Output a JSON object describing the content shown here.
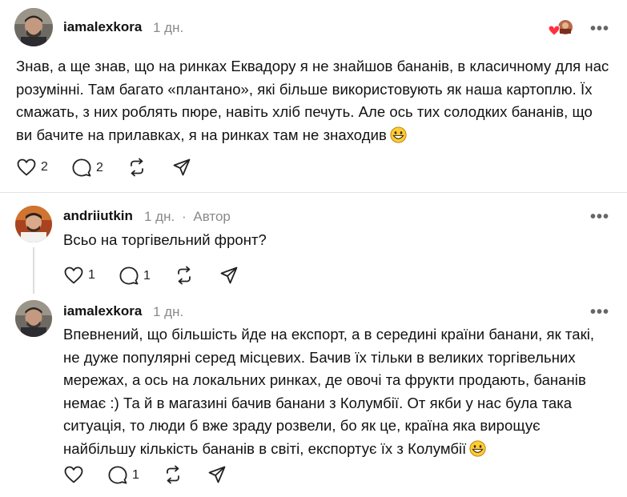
{
  "post": {
    "username": "iamalexkora",
    "time": "1 дн.",
    "lines": [
      "Знав, а ще знав, що на ринках Еквадору я не знайшов бананів, в класичному для нас",
      "розумінні. Там багато «плантано», які більше використовують як наша картоплю. Їх",
      "смажать, з них роблять пюре, навіть хліб печуть. Але ось тих солодких бананів, що",
      "ви бачите на прилавках, я на ринках там не знаходив"
    ],
    "likes": "2",
    "replies": "2",
    "more": "•••"
  },
  "reply1": {
    "username": "andriiutkin",
    "time": "1 дн.",
    "separator": "·",
    "author_badge": "Автор",
    "text": "Всьо на торгівельний фронт?",
    "likes": "1",
    "replies": "1",
    "more": "•••"
  },
  "reply2": {
    "username": "iamalexkora",
    "time": "1 дн.",
    "lines": [
      "Впевнений, що більшість йде на експорт, а в середині країни банани, як такі,",
      "не дуже популярні серед місцевих. Бачив їх тільки в великих торгівельних",
      "мережах, а ось на локальних ринках, де овочі та фрукти продають, бананів",
      "немає :) Та й в магазині бачив банани з Колумбії. От якби у нас була така",
      "ситуація, то люди б вже зраду розвели, бо як це, країна яка вирощує",
      "найбільшу кількість бананів в світі, експортує їх з Колумбії"
    ],
    "replies": "1",
    "more": "•••"
  },
  "icons": {
    "like": "heart-outline-icon",
    "reply": "speech-bubble-icon",
    "repost": "repost-arrows-icon",
    "share": "paper-plane-icon",
    "emoji": "grinning-face-emoji",
    "liked_by": "red-heart-badge-icon"
  },
  "colors": {
    "text": "#111111",
    "muted": "#8a8a8a",
    "divider": "#e3e3e3",
    "heart_red": "#ff3040"
  }
}
